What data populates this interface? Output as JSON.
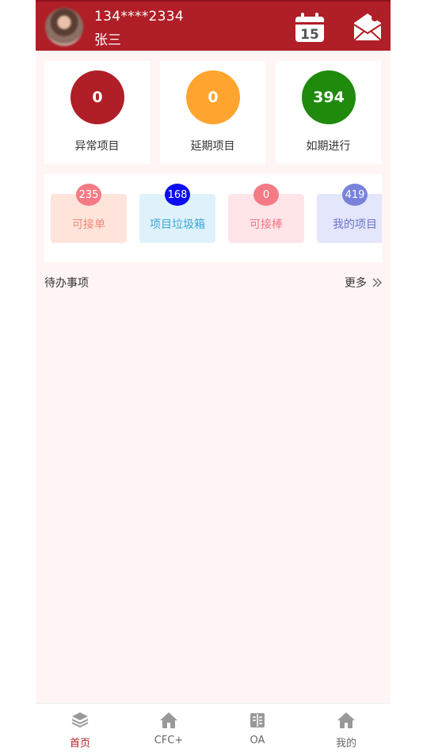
{
  "header": {
    "phone": "134****2334",
    "name": "张三",
    "calendar_day": "15"
  },
  "stats": [
    {
      "value": "0",
      "label": "异常项目",
      "color": "#b01e27"
    },
    {
      "value": "0",
      "label": "延期项目",
      "color": "#ffa42e"
    },
    {
      "value": "394",
      "label": "如期进行",
      "color": "#1f8a0c"
    }
  ],
  "quick": [
    {
      "label": "可接单",
      "badge": "235"
    },
    {
      "label": "项目垃圾箱",
      "badge": "168"
    },
    {
      "label": "可接棒",
      "badge": "0"
    },
    {
      "label": "我的项目",
      "badge": "419"
    }
  ],
  "todo": {
    "title": "待办事项",
    "more": "更多"
  },
  "tabs": [
    {
      "label": "首页",
      "icon": "layers-icon"
    },
    {
      "label": "CFC+",
      "icon": "home-icon"
    },
    {
      "label": "OA",
      "icon": "book-icon"
    },
    {
      "label": "我的",
      "icon": "home-icon"
    }
  ],
  "colors": {
    "brand": "#b01e27"
  }
}
